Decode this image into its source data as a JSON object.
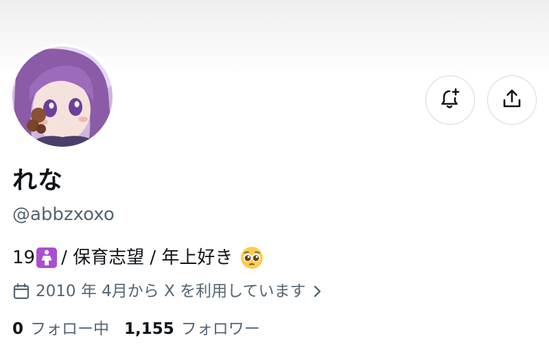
{
  "profile": {
    "display_name": "れな",
    "handle": "@abbzxoxo",
    "bio": {
      "age": "19",
      "age_badge_icon": "female-sign-icon",
      "text": " / 保育志望 / 年上好き",
      "trailing_emoji_icon": "pleading-face-emoji-icon"
    },
    "joined": {
      "icon": "calendar-icon",
      "text": "2010 年 4月から X を利用しています",
      "chevron_icon": "chevron-right-icon"
    },
    "stats": {
      "following_count": "0",
      "following_label": "フォロー中",
      "followers_count": "1,155",
      "followers_label": "フォロワー"
    }
  },
  "actions": {
    "notify_icon": "bell-plus-icon",
    "share_icon": "share-upload-icon"
  },
  "colors": {
    "text_primary": "#0f1419",
    "text_secondary": "#536471",
    "border": "#cfd9de",
    "badge_purple": "#a94ed0"
  }
}
